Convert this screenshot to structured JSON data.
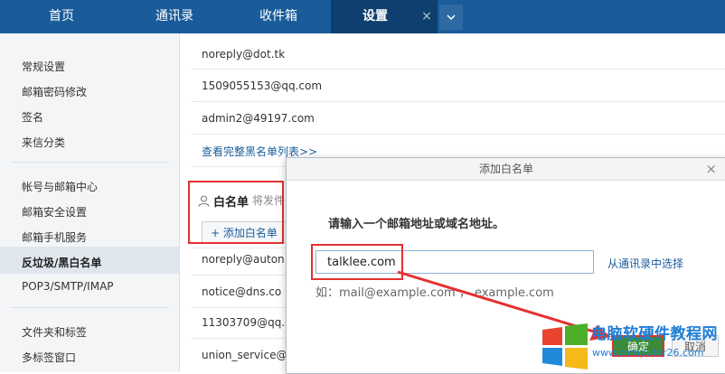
{
  "tabs": [
    {
      "label": "首页"
    },
    {
      "label": "通讯录"
    },
    {
      "label": "收件箱"
    },
    {
      "label": "设置"
    }
  ],
  "sidebar": {
    "items": [
      {
        "label": "常规设置"
      },
      {
        "label": "邮箱密码修改"
      },
      {
        "label": "签名"
      },
      {
        "label": "来信分类"
      },
      {
        "label": "帐号与邮箱中心"
      },
      {
        "label": "邮箱安全设置"
      },
      {
        "label": "邮箱手机服务"
      },
      {
        "label": "反垃圾/黑白名单"
      },
      {
        "label": "POP3/SMTP/IMAP"
      },
      {
        "label": "文件夹和标签"
      },
      {
        "label": "多标签窗口"
      }
    ]
  },
  "blacklist": {
    "entries": [
      "noreply@dot.tk",
      "1509055153@qq.com",
      "admin2@49197.com"
    ],
    "view_all_link": "查看完整黑名单列表>>"
  },
  "whitelist": {
    "title": "白名单",
    "desc": "将发件",
    "add_button": "+ 添加白名单",
    "entries": [
      "noreply@auton",
      "notice@dns.co",
      "11303709@qq.c",
      "union_service@"
    ]
  },
  "dialog": {
    "title": "添加白名单",
    "close": "×",
    "prompt": "请输入一个邮箱地址或域名地址。",
    "input_value": "talklee.com",
    "contacts_link": "从通讯录中选择",
    "example": "如：mail@example.com ， example.com",
    "ok_button": "确定",
    "cancel_button": "取消"
  },
  "watermark": {
    "brand": "电脑软硬件教程网",
    "url": "www.computer26.com"
  },
  "colors": {
    "topbar": "#1a5c9a",
    "highlight_red": "#e53030",
    "ok_green": "#3c8b3a"
  }
}
